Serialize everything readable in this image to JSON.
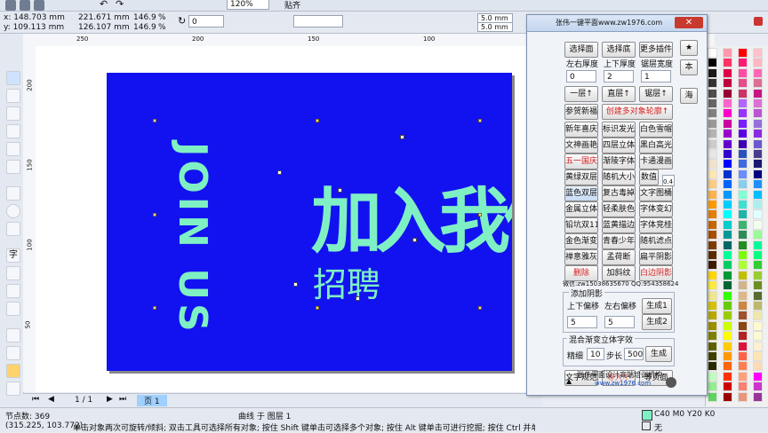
{
  "top_toolbar": {
    "zoom": "120%",
    "snap": "贴齐",
    "angle": "0",
    "scale_w": "146.9",
    "scale_h": "146.9",
    "pct_w": "%",
    "pct_h": "%",
    "offset_x": "5.0 mm",
    "offset_y": "5.0 mm"
  },
  "property_bar": {
    "x": "x: 148.703 mm",
    "y": "y: 109.113 mm",
    "w": "221.671 mm",
    "h": "126.107 mm"
  },
  "ruler_marks": [
    "250",
    "200",
    "150",
    "100",
    "50"
  ],
  "vruler_marks": [
    "200",
    "150",
    "100",
    "50"
  ],
  "artwork": {
    "en_text": "JOIN US",
    "cn_big": "加入我们",
    "cn_small": "招聘"
  },
  "page_nav": {
    "counter": "1 / 1",
    "page_tab": "页 1"
  },
  "status": {
    "nodes": "节点数: 369",
    "object_info": "曲线 于 图层 1",
    "coords": "(315.225, 103.772)",
    "hint": "单击对象两次可旋转/倾斜; 双击工具可选择所有对象; 按住 Shift 键单击可选择多个对象; 按住 Alt 键单击可进行挖掘; 按住 Ctrl 并单...",
    "fill_label": "C40 M0 Y20 K0",
    "outline_label": "无"
  },
  "plugin": {
    "title": "张伟一键平面www.zw1976.com",
    "side_buttons": [
      "★",
      "本",
      "海"
    ],
    "row1": [
      "选择面",
      "选择底",
      "更多插件"
    ],
    "row2": [
      "左右厚度",
      "上下厚度",
      "锯层宽度"
    ],
    "spin_vals": [
      "0",
      "2",
      "1"
    ],
    "row3": [
      "一层↑",
      "直层↑",
      "锯层↑"
    ],
    "row4": [
      "参贺新福",
      "创建多对象轮廓↑"
    ],
    "grid": [
      [
        "新年喜庆",
        "标识发光",
        "白色雪帽"
      ],
      [
        "文神画艳",
        "四层立体",
        "黑白高光"
      ],
      [
        "五一国庆",
        "渐陵字体",
        "卡通漫画"
      ],
      [
        "黄绿双层",
        "随机大小",
        "数值"
      ],
      [
        "蓝色双层",
        "复古毒掉",
        "文字图桶"
      ],
      [
        "金属立体",
        "轻柔肤色",
        "字体变幻"
      ],
      [
        "铅坑双11",
        "蓝黄描边",
        "字体竞桂"
      ],
      [
        "金色渐变",
        "青春少年",
        "随机滤点"
      ],
      [
        "禅意雅灰",
        "孟荷断",
        "扁平阴影"
      ],
      [
        "删除",
        "加斜纹",
        "白边阴影"
      ]
    ],
    "number_box": "0.4",
    "contact": "微信:zw15038635670   QQ:954358624",
    "shadow_section": "添加阴影",
    "shadow_row": [
      "上下偏移",
      "左右偏移",
      "生成1"
    ],
    "shadow_vals": [
      "5",
      "5"
    ],
    "shadow_btn2": "生成2",
    "gradient_section": "混合渐变立体字效",
    "grad_labels": [
      "精细",
      "步长"
    ],
    "grad_vals": [
      "10",
      "500"
    ],
    "grad_btn": "生成",
    "bottom_row": [
      "文字规范",
      "等大小",
      "等页面"
    ],
    "footer": "张伟平面设计高端培训机构",
    "footer_url": "www.zw1976.com"
  },
  "colors": {
    "canvas_bg": "#1212f0",
    "art_color": "#7ff0c3",
    "workspace": "#ffffff"
  }
}
